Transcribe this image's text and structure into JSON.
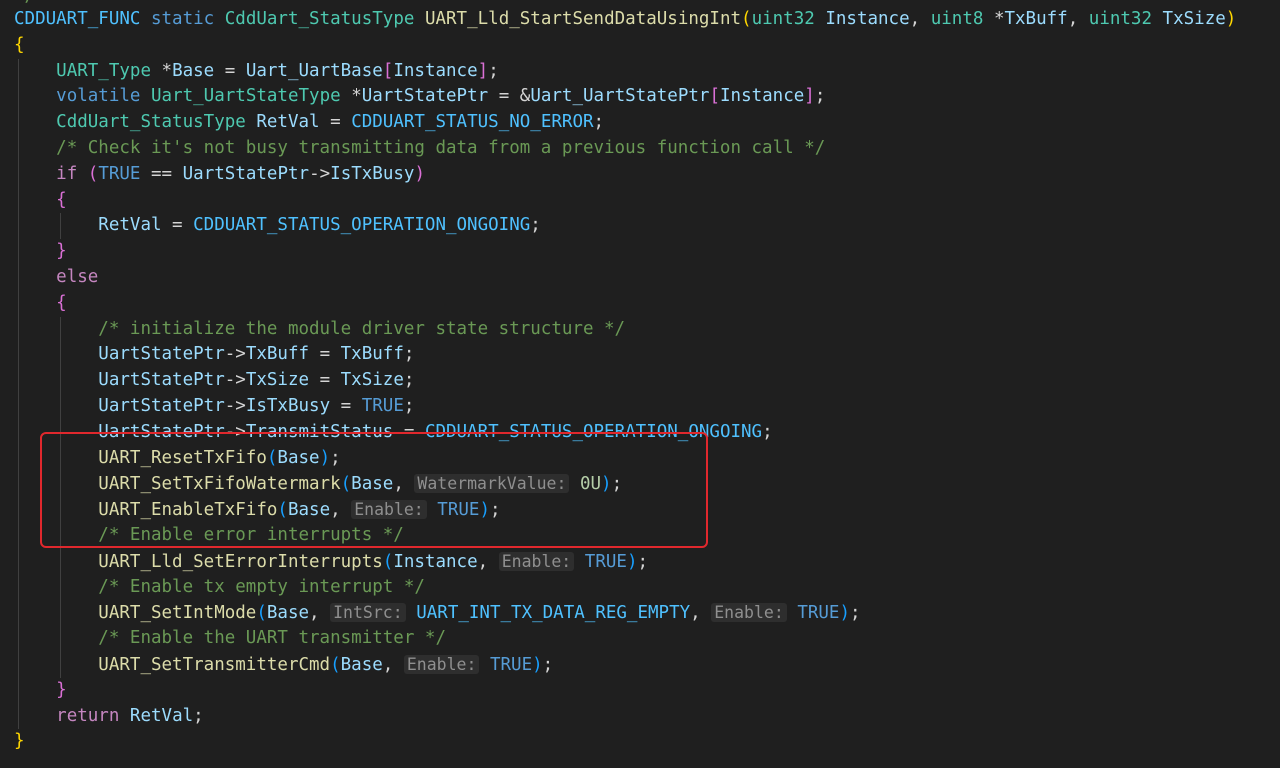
{
  "colors": {
    "background": "#1f1f1f",
    "keyword": "#569cd6",
    "control_keyword": "#c586c0",
    "type": "#4ec9b0",
    "function": "#dcdcaa",
    "variable": "#9cdcfe",
    "macro": "#4fc1ff",
    "comment": "#6a9955",
    "number": "#b5cea8",
    "inlay_hint_text": "#8f8f8f",
    "highlight_box": "#e0282d"
  },
  "code": {
    "top_clipped": "*/",
    "signature": {
      "macro": "CDDUART_FUNC",
      "storage": "static",
      "return_type": "CddUart_StatusType",
      "function": "UART_Lld_StartSendDataUsingInt",
      "p1_type": "uint32",
      "p1_name": "Instance",
      "p2_type": "uint8",
      "p2_name": "TxBuff",
      "p3_type": "uint32",
      "p3_name": "TxSize"
    },
    "decls": {
      "uart_type": "UART_Type",
      "base": "Base",
      "uart_base_fn": "Uart_UartBase",
      "instance": "Instance",
      "volatile": "volatile",
      "state_type": "Uart_UartStateType",
      "state_ptr": "UartStatePtr",
      "state_arr": "Uart_UartStatePtr",
      "status_type": "CddUart_StatusType",
      "retval": "RetVal",
      "no_error": "CDDUART_STATUS_NO_ERROR"
    },
    "comments": {
      "busy_check": "/* Check it's not busy transmitting data from a previous function call */",
      "init_state": "/* initialize the module driver state structure */",
      "enable_err": "/* Enable error interrupts */",
      "enable_tx_empty": "/* Enable tx empty interrupt */",
      "enable_tx": "/* Enable the UART transmitter */"
    },
    "keywords": {
      "if": "if",
      "else": "else",
      "return": "return",
      "true": "TRUE",
      "ongoing": "CDDUART_STATUS_OPERATION_ONGOING"
    },
    "fields": {
      "is_tx_busy": "IsTxBusy",
      "tx_buff": "TxBuff",
      "tx_size": "TxSize",
      "transmit_status": "TransmitStatus"
    },
    "calls": {
      "reset_fifo": "UART_ResetTxFifo",
      "set_watermark": "UART_SetTxFifoWatermark",
      "enable_fifo": "UART_EnableTxFifo",
      "set_err_int": "UART_Lld_SetErrorInterrupts",
      "set_int_mode": "UART_SetIntMode",
      "set_tx_cmd": "UART_SetTransmitterCmd",
      "int_src_value": "UART_INT_TX_DATA_REG_EMPTY",
      "watermark_value": "0U"
    },
    "hints": {
      "watermark": "WatermarkValue:",
      "enable": "Enable:",
      "int_src": "IntSrc:"
    }
  }
}
